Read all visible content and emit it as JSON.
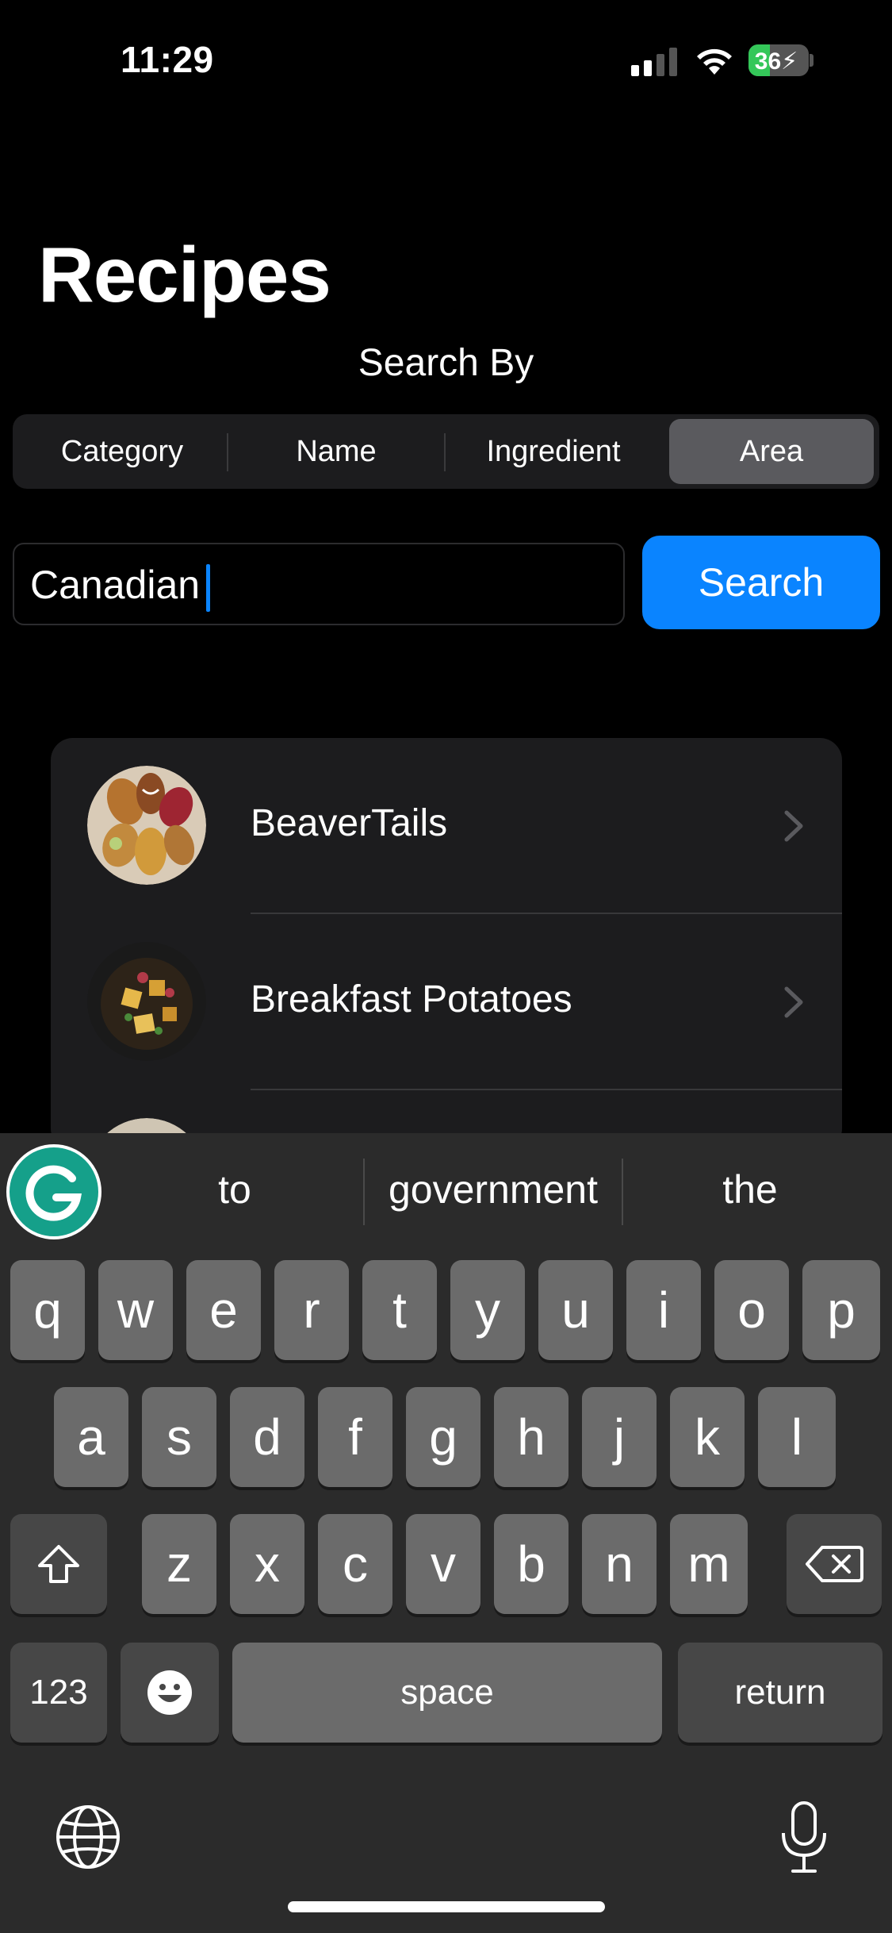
{
  "status_bar": {
    "time": "11:29",
    "battery_level": 36,
    "battery_text": "36"
  },
  "header": {
    "title": "Recipes",
    "search_by_label": "Search By"
  },
  "segmented": {
    "options": [
      "Category",
      "Name",
      "Ingredient",
      "Area"
    ],
    "selected": "Area"
  },
  "search": {
    "value": "Canadian",
    "button_label": "Search"
  },
  "results": [
    {
      "name": "BeaverTails"
    },
    {
      "name": "Breakfast Potatoes"
    }
  ],
  "keyboard": {
    "suggestions": [
      "to",
      "government",
      "the"
    ],
    "row1": [
      "q",
      "w",
      "e",
      "r",
      "t",
      "y",
      "u",
      "i",
      "o",
      "p"
    ],
    "row2": [
      "a",
      "s",
      "d",
      "f",
      "g",
      "h",
      "j",
      "k",
      "l"
    ],
    "row3": [
      "z",
      "x",
      "c",
      "v",
      "b",
      "n",
      "m"
    ],
    "numbers_label": "123",
    "space_label": "space",
    "return_label": "return"
  },
  "colors": {
    "accent": "#0a84ff",
    "battery_green": "#34c759",
    "grammarly": "#15a08a"
  }
}
